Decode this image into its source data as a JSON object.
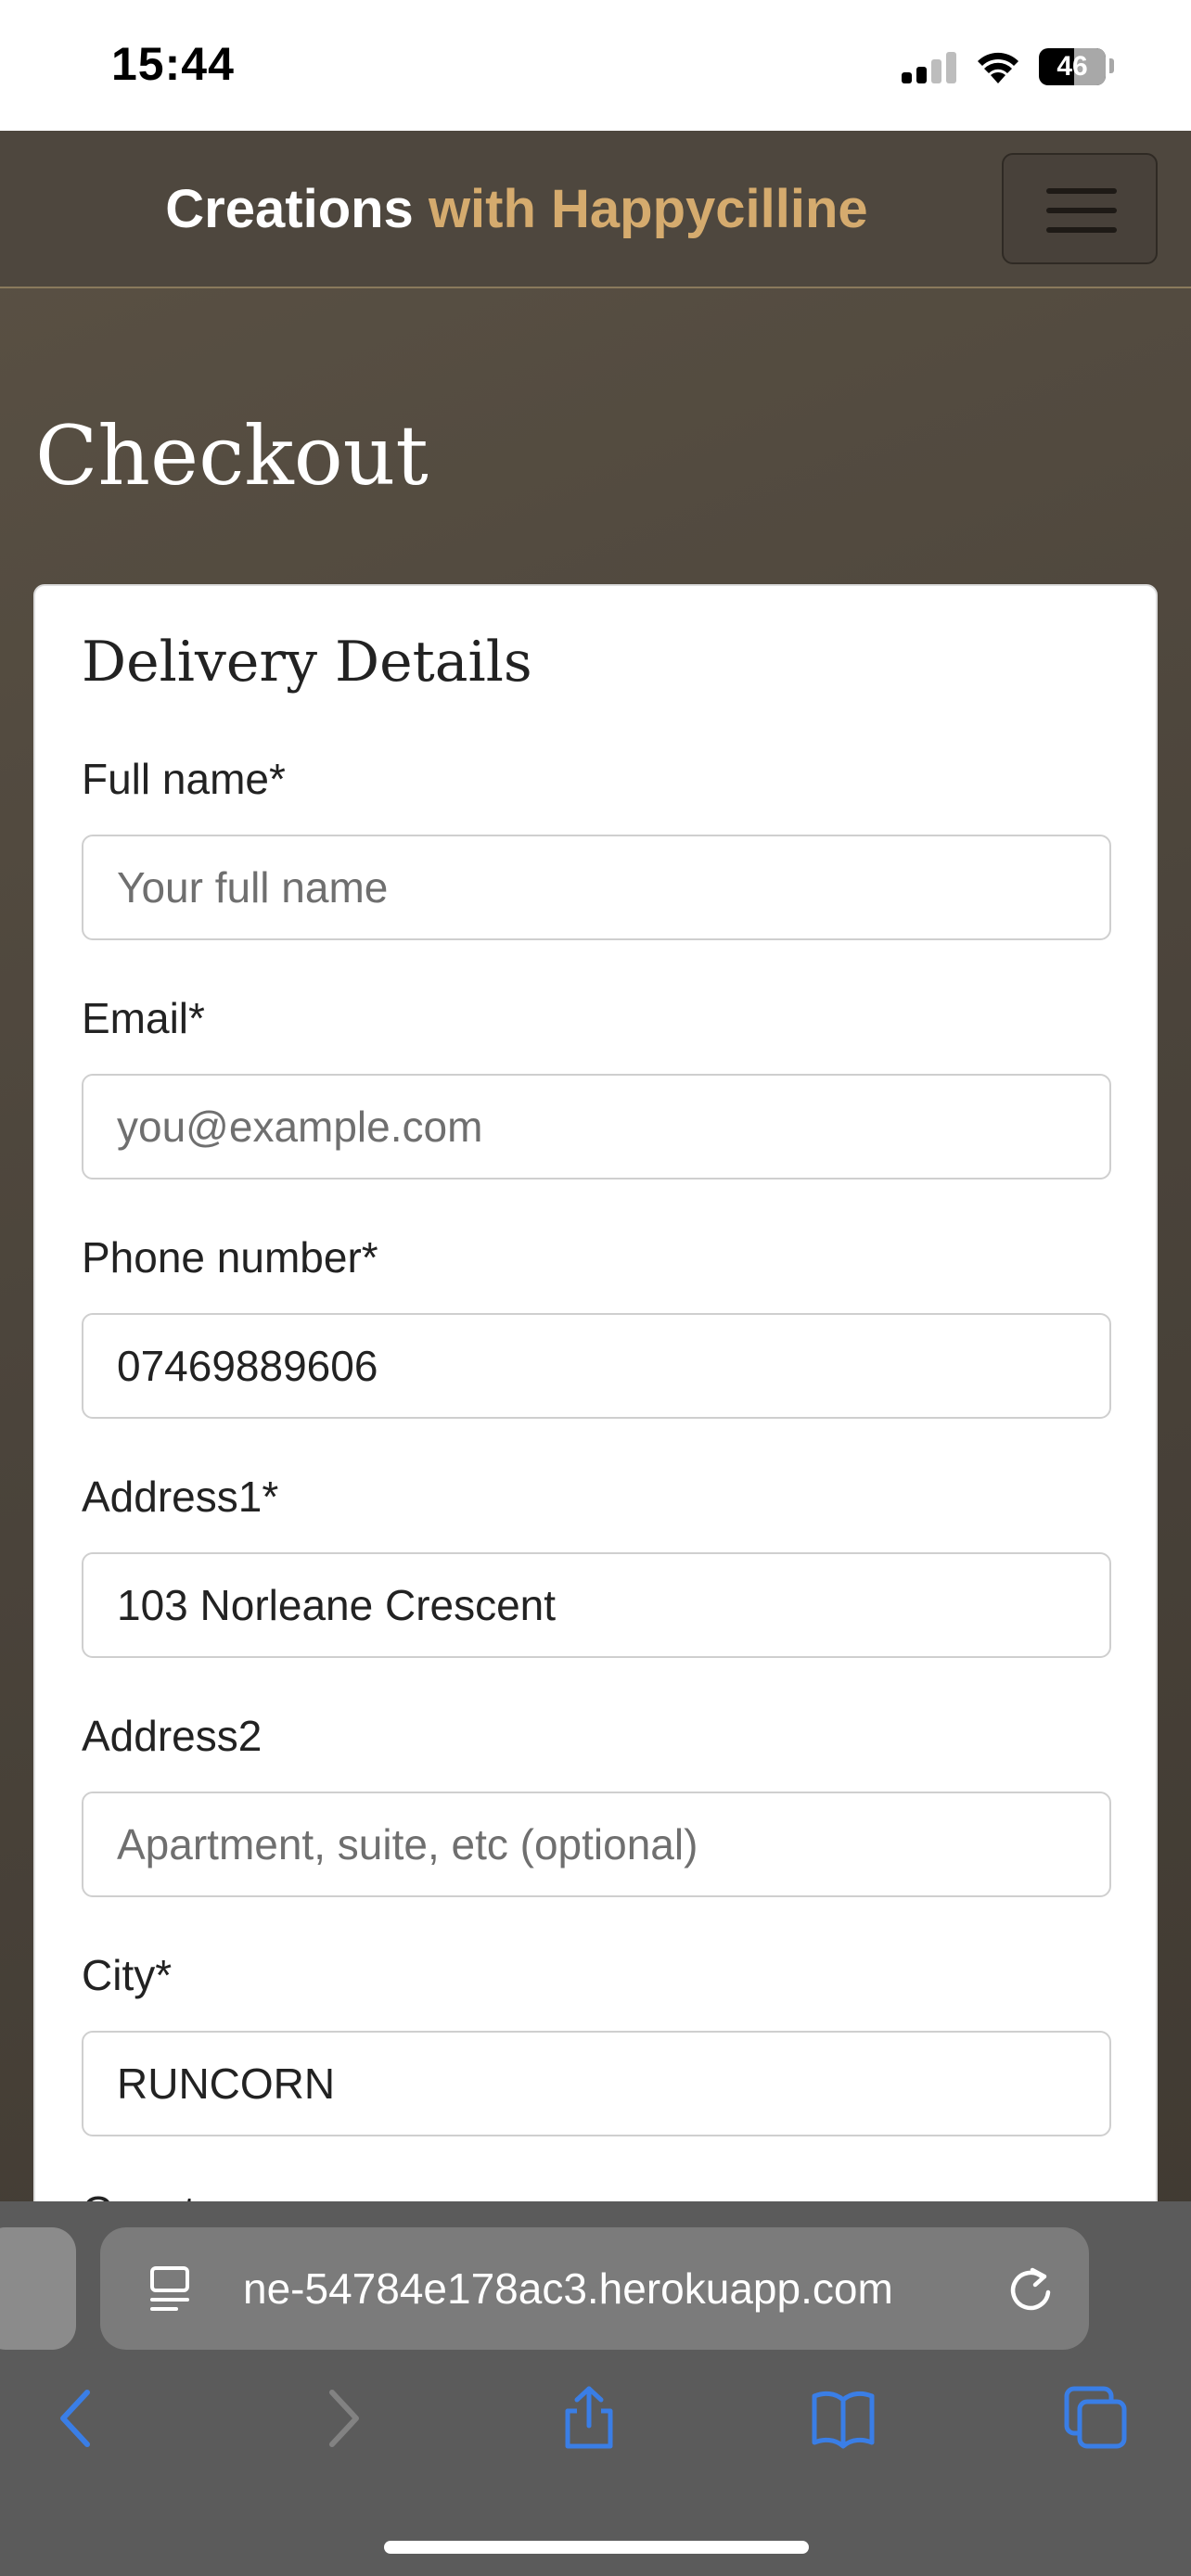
{
  "status_bar": {
    "time": "15:44",
    "battery_level": "46",
    "signal_bars": 2,
    "signal_bars_total": 4
  },
  "navbar": {
    "brand_primary": "Creations",
    "brand_accent": "with Happycilline",
    "accent_color": "#d5ab6e",
    "menu_icon": "hamburger-menu-icon"
  },
  "page": {
    "title": "Checkout"
  },
  "delivery": {
    "heading": "Delivery Details",
    "fields": [
      {
        "label": "Full name*",
        "value": "",
        "placeholder": "Your full name"
      },
      {
        "label": "Email*",
        "value": "",
        "placeholder": "you@example.com"
      },
      {
        "label": "Phone number*",
        "value": "07469889606",
        "placeholder": ""
      },
      {
        "label": "Address1*",
        "value": "103 Norleane Crescent",
        "placeholder": ""
      },
      {
        "label": "Address2",
        "value": "",
        "placeholder": "Apartment, suite, etc (optional)"
      },
      {
        "label": "City*",
        "value": "RUNCORN",
        "placeholder": ""
      }
    ],
    "next_label_partial": "Count"
  },
  "browser": {
    "url": "ne-54784e178ac3.herokuapp.com",
    "icons": [
      "reader-mode-icon",
      "reload-icon",
      "back-icon",
      "forward-icon",
      "share-icon",
      "bookmarks-icon",
      "tabs-icon"
    ],
    "ui_color": "#3a7ee6"
  }
}
